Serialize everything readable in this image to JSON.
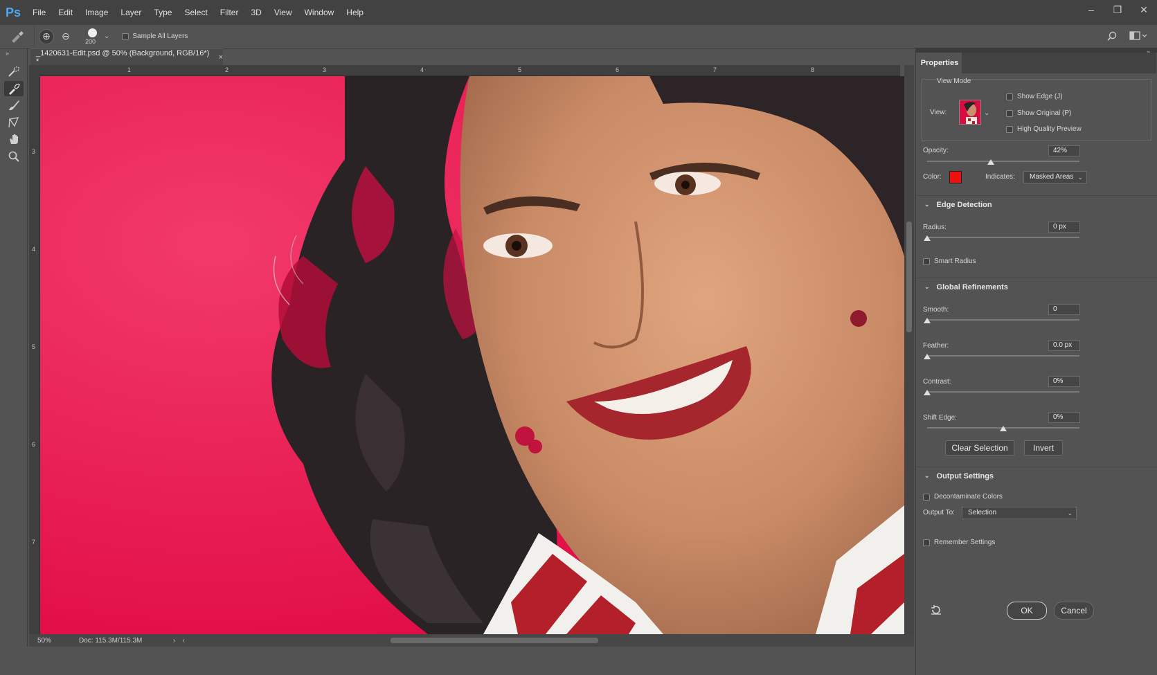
{
  "app": {
    "logo": "Ps",
    "accent": "#4ea6f5"
  },
  "menu": [
    "File",
    "Edit",
    "Image",
    "Layer",
    "Type",
    "Select",
    "Filter",
    "3D",
    "View",
    "Window",
    "Help"
  ],
  "window_controls": {
    "minimize": "–",
    "restore": "❐",
    "close": "✕"
  },
  "options_bar": {
    "brush_size": "200",
    "sample_all_layers_label": "Sample All Layers",
    "sample_all_layers_checked": false
  },
  "document": {
    "tab_title": "_1420631-Edit.psd @ 50% (Background, RGB/16*) *",
    "close": "×",
    "ruler_h_ticks": [
      "1",
      "2",
      "3",
      "4",
      "5",
      "6",
      "7",
      "8"
    ],
    "ruler_v_ticks": [
      "3",
      "4",
      "5",
      "6",
      "7"
    ],
    "zoom": "50%",
    "doc_size": "Doc: 115.3M/115.3M",
    "overlay_color": "#e8104a"
  },
  "properties": {
    "tab": "Properties",
    "view_mode": {
      "title": "View Mode",
      "view_label": "View:",
      "show_edge": "Show Edge (J)",
      "show_original": "Show Original (P)",
      "high_quality": "High Quality Preview"
    },
    "opacity": {
      "label": "Opacity:",
      "value": "42%",
      "level": 0.42
    },
    "color": {
      "label": "Color:",
      "swatch": "#ee1010"
    },
    "indicates": {
      "label": "Indicates:",
      "value": "Masked Areas"
    },
    "edge_detection": {
      "title": "Edge Detection",
      "radius_label": "Radius:",
      "radius_value": "0 px",
      "smart_radius": "Smart Radius"
    },
    "global_refinements": {
      "title": "Global Refinements",
      "smooth_label": "Smooth:",
      "smooth_value": "0",
      "feather_label": "Feather:",
      "feather_value": "0.0 px",
      "contrast_label": "Contrast:",
      "contrast_value": "0%",
      "shift_edge_label": "Shift Edge:",
      "shift_edge_value": "0%"
    },
    "clear_selection": "Clear Selection",
    "invert": "Invert",
    "output_settings": {
      "title": "Output Settings",
      "decontaminate": "Decontaminate Colors",
      "output_to_label": "Output To:",
      "output_to_value": "Selection",
      "remember": "Remember Settings"
    },
    "ok": "OK",
    "cancel": "Cancel"
  }
}
